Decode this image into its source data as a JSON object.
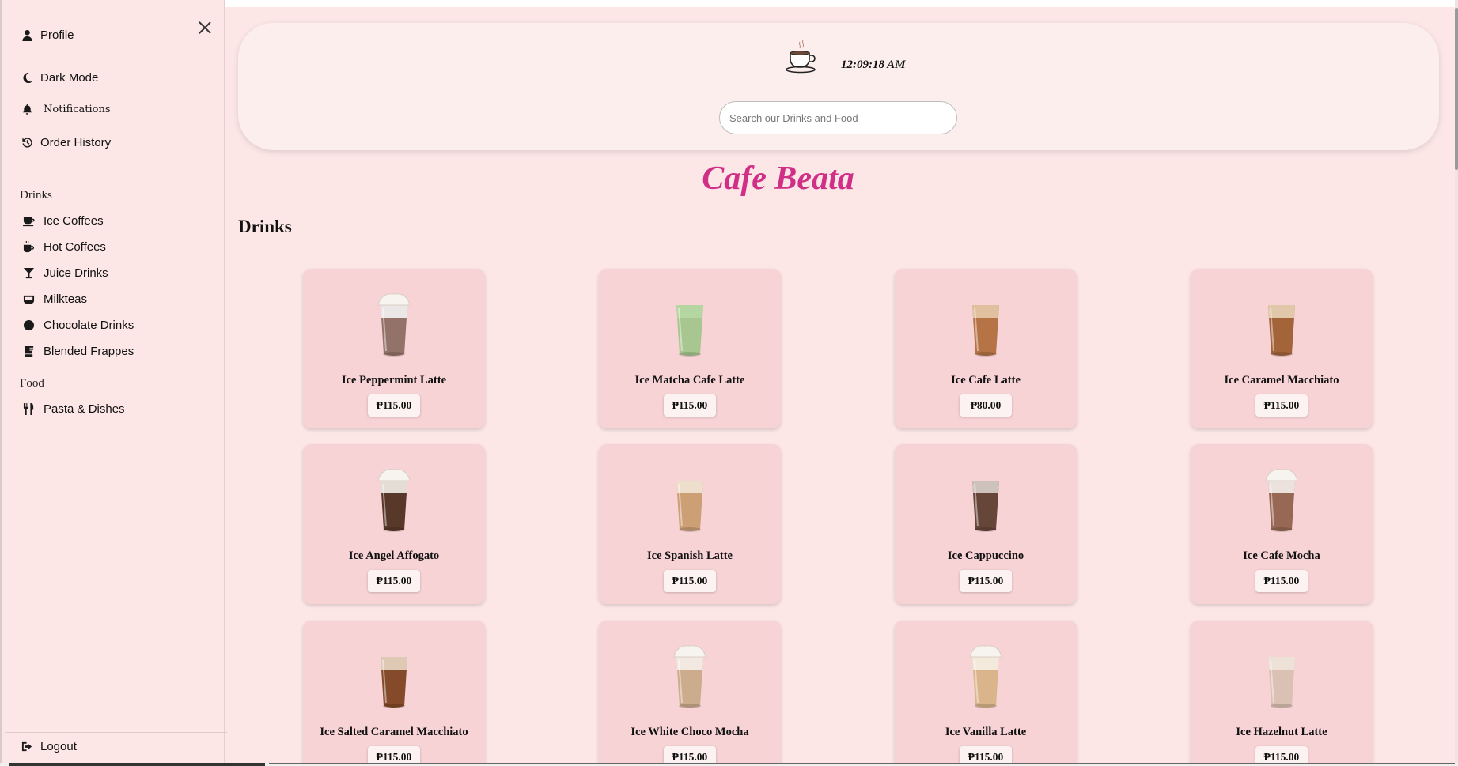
{
  "sidebar": {
    "top_items": [
      {
        "label": "Profile",
        "icon": "user-icon"
      },
      {
        "label": "Dark Mode",
        "icon": "moon-icon"
      },
      {
        "label": "Notifications",
        "icon": "bell-icon"
      },
      {
        "label": "Order History",
        "icon": "history-icon"
      }
    ],
    "drinks_heading": "Drinks",
    "drinks": [
      {
        "label": "Ice Coffees",
        "icon": "mug-icon"
      },
      {
        "label": "Hot Coffees",
        "icon": "mug-hot-icon"
      },
      {
        "label": "Juice Drinks",
        "icon": "cocktail-icon"
      },
      {
        "label": "Milkteas",
        "icon": "bowl-icon"
      },
      {
        "label": "Chocolate Drinks",
        "icon": "cookie-icon"
      },
      {
        "label": "Blended Frappes",
        "icon": "blender-icon"
      }
    ],
    "food_heading": "Food",
    "food": [
      {
        "label": "Pasta & Dishes",
        "icon": "utensils-icon"
      }
    ],
    "logout": "Logout"
  },
  "header": {
    "time": "12:09:18 AM",
    "search_placeholder": "Search our Drinks and Food"
  },
  "brand": "Cafe Beata",
  "section_title": "Drinks",
  "products": [
    {
      "name": "Ice Peppermint Latte",
      "price": "₱115.00"
    },
    {
      "name": "Ice Matcha Cafe Latte",
      "price": "₱115.00"
    },
    {
      "name": "Ice Cafe Latte",
      "price": "₱80.00"
    },
    {
      "name": "Ice Caramel Macchiato",
      "price": "₱115.00"
    },
    {
      "name": "Ice Angel Affogato",
      "price": "₱115.00"
    },
    {
      "name": "Ice Spanish Latte",
      "price": "₱115.00"
    },
    {
      "name": "Ice Cappuccino",
      "price": "₱115.00"
    },
    {
      "name": "Ice Cafe Mocha",
      "price": "₱115.00"
    },
    {
      "name": "Ice Salted Caramel Macchiato",
      "price": "₱115.00"
    },
    {
      "name": "Ice White Choco Mocha",
      "price": "₱115.00"
    },
    {
      "name": "Ice Vanilla Latte",
      "price": "₱115.00"
    },
    {
      "name": "Ice Hazelnut Latte",
      "price": "₱115.00"
    }
  ],
  "colors": {
    "background": "#fce6e6",
    "card": "#f7d3d5",
    "brand": "#cf2f86"
  }
}
